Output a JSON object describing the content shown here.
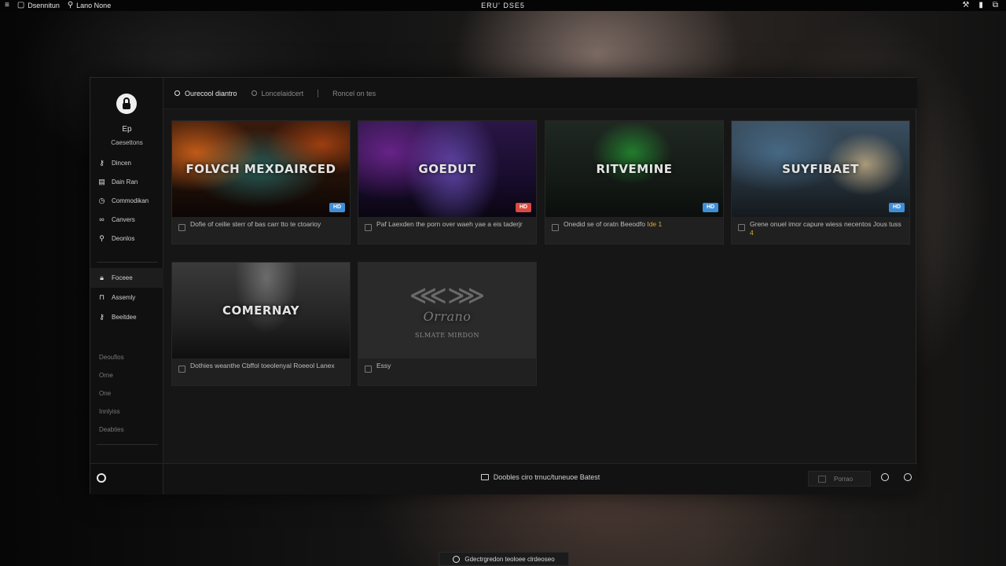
{
  "sysbar": {
    "menu_icon": "hamburger-icon",
    "item1": "Dsennitun",
    "item2": "Lano None",
    "title": "ERU' DSE5",
    "right_icons": [
      "wrench-icon",
      "battery-icon",
      "window-icon"
    ]
  },
  "sidebar": {
    "app_name": "Ep",
    "app_sub": "Caesettons",
    "nav": [
      {
        "label": "Dincen",
        "icon": "key-icon"
      },
      {
        "label": "Dain Ran",
        "icon": "file-icon"
      },
      {
        "label": "Commodikan",
        "icon": "clock-icon"
      },
      {
        "label": "Canvers",
        "icon": "link-icon"
      },
      {
        "label": "Deonlos",
        "icon": "search-icon"
      }
    ],
    "nav2": [
      {
        "label": "Foceee",
        "icon": "lock-icon"
      },
      {
        "label": "Assemly",
        "icon": "lock-icon"
      },
      {
        "label": "Beeitdee",
        "icon": "key-icon"
      }
    ],
    "nav3": [
      "Deoufios",
      "Orne",
      "One",
      "Innlyiss",
      "Deabties"
    ]
  },
  "tabs": [
    {
      "label": "Ourecool diantro",
      "active": true
    },
    {
      "label": "Loncelaidcert",
      "active": false
    },
    {
      "label": "Roncel on tes",
      "active": false
    }
  ],
  "cards": [
    {
      "title": "FOLVCH MEXDAIRCED",
      "badge": "HD",
      "badge_color": "#3f8fd8",
      "desc": "Dofie of ceilie sterr of bas carr tto te ctoarioy",
      "highlight": ""
    },
    {
      "title": "GOEDUT",
      "badge": "HD",
      "badge_color": "#d84a3f",
      "desc": "Paf Laexden the porn over waeh yae a eis taderjr",
      "highlight": ""
    },
    {
      "title": "RITVEMINE",
      "badge": "HD",
      "badge_color": "#3f8fd8",
      "desc": "Onedid se of oratn Beeodfo",
      "highlight": "Ide 1"
    },
    {
      "title": "SUYFIBAET",
      "badge": "HD",
      "badge_color": "#3f8fd8",
      "desc": "Grene onuel imor capure wiess necentos Jous tuss",
      "highlight": "4"
    },
    {
      "title": "COMERNAY",
      "badge": "",
      "badge_color": "",
      "desc": "Dothies weanthe Cbffol toeolenyal Roeeol Lanex",
      "highlight": ""
    },
    {
      "title": "Orrano",
      "subtitle": "SLMATE MIRDON",
      "badge": "",
      "badge_color": "",
      "desc": "Essy",
      "highlight": ""
    }
  ],
  "status": "Doobles ciro trnuc/tuneuoe Batest",
  "filter_label": "Porrao",
  "toast": "Gdectrgredon teoloee clrdeoseo"
}
